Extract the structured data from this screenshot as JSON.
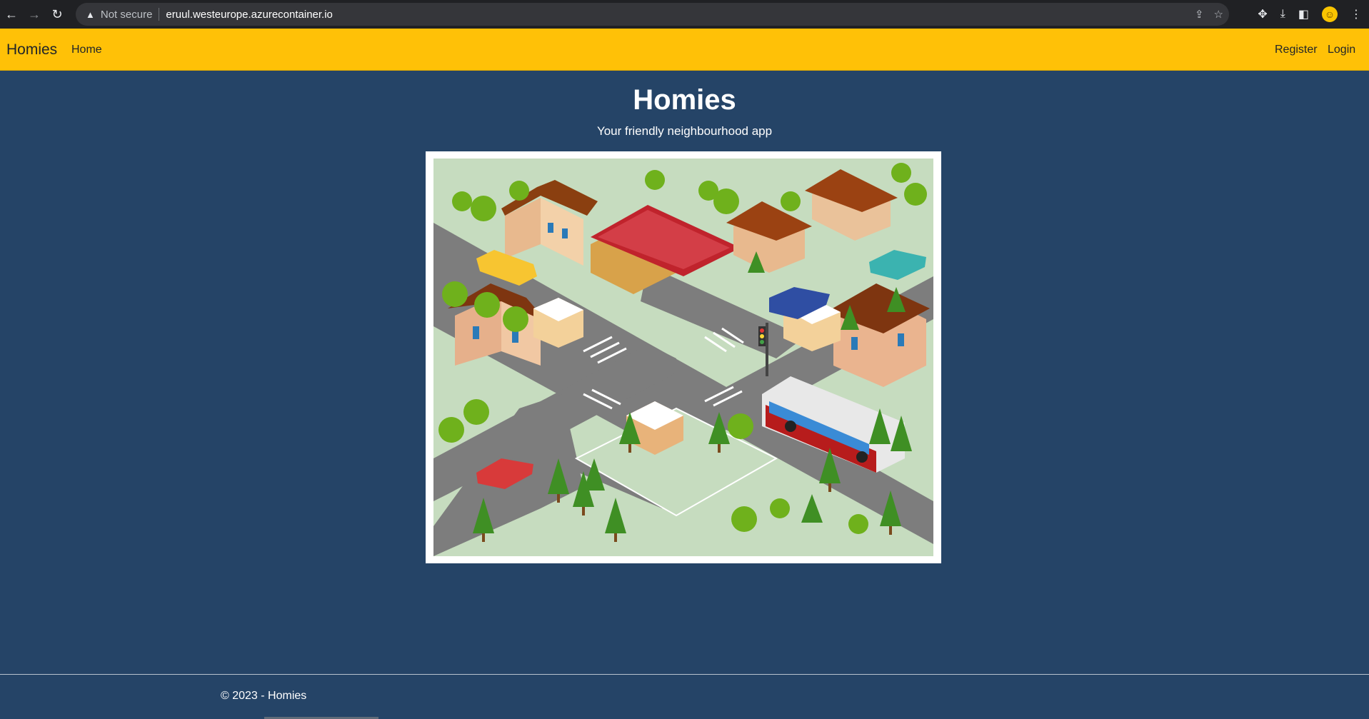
{
  "browser": {
    "security_label": "Not secure",
    "url": "eruul.westeurope.azurecontainer.io"
  },
  "navbar": {
    "brand": "Homies",
    "home": "Home",
    "register": "Register",
    "login": "Login",
    "bg_color": "#ffc107"
  },
  "hero": {
    "title": "Homies",
    "subtitle": "Your friendly neighbourhood app"
  },
  "footer": {
    "text": "© 2023 - Homies"
  },
  "colors": {
    "page_bg": "#254467",
    "grass": "#c6dcbf",
    "road": "#7d7d7d"
  },
  "icons": [
    "back-arrow-icon",
    "forward-arrow-icon",
    "reload-icon",
    "warning-icon",
    "share-icon",
    "star-icon",
    "puzzle-icon",
    "download-icon",
    "sidebar-icon",
    "profile-icon",
    "kebab-menu-icon"
  ]
}
